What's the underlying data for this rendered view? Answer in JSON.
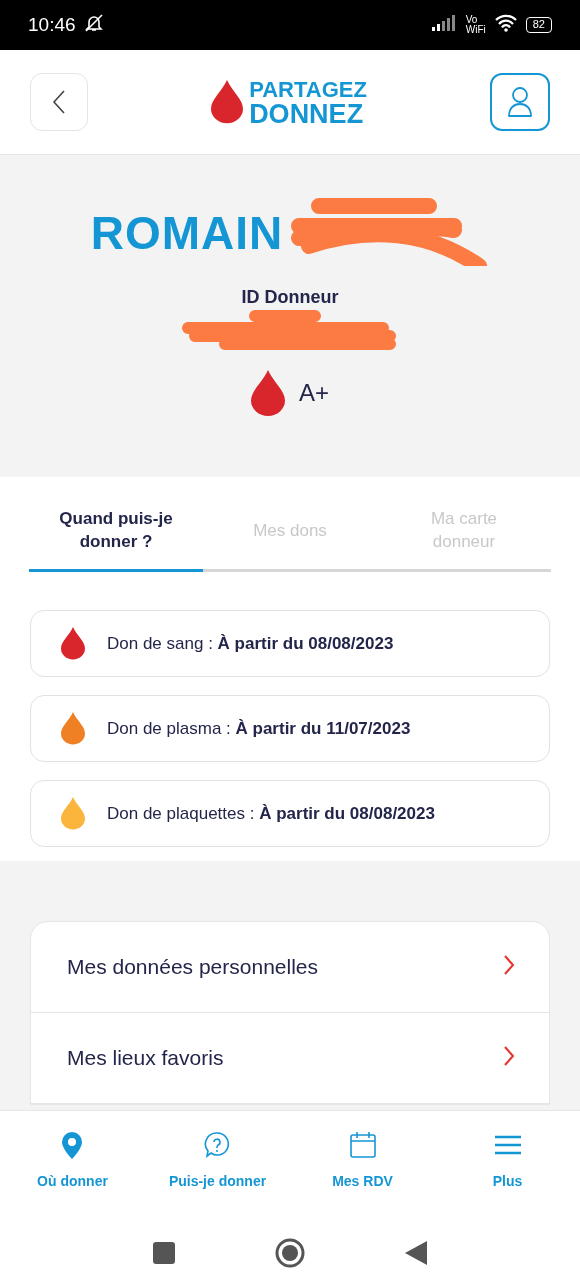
{
  "status_bar": {
    "time": "10:46",
    "vo": "Vo",
    "wifi_label": "WiFi",
    "battery": "82"
  },
  "header": {
    "logo_line_1": "PARTAGEZ",
    "logo_line_2": "DONNEZ"
  },
  "profile": {
    "name": "ROMAIN",
    "id_label": "ID Donneur",
    "blood_group": "A+"
  },
  "tabs": [
    {
      "label": "Quand puis-je donner ?",
      "selected": true
    },
    {
      "label": "Mes dons",
      "selected": false
    },
    {
      "label": "Ma carte donneur",
      "selected": false
    }
  ],
  "donations": [
    {
      "text": "Don de sang : **À partir du 08/08/2023**",
      "color": "#d9262c"
    },
    {
      "text": "Don de plasma : **À partir du 11/07/2023**",
      "color": "#f08024"
    },
    {
      "text": "Don de plaquettes : **À partir du 08/08/2023**",
      "color": "#fbb53c"
    }
  ],
  "menu": [
    {
      "label": "Mes données personnelles"
    },
    {
      "label": "Mes lieux favoris"
    }
  ],
  "bottom_nav": [
    {
      "kind": "pin",
      "label": "Où donner"
    },
    {
      "kind": "question",
      "label": "Puis-je donner"
    },
    {
      "kind": "calendar",
      "label": "Mes RDV"
    },
    {
      "kind": "menu",
      "label": "Plus"
    }
  ]
}
